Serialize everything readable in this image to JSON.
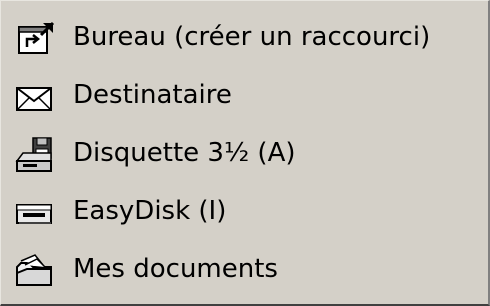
{
  "menu": {
    "items": [
      {
        "label": "Bureau (créer un raccourci)",
        "icon": "desktop-shortcut-icon"
      },
      {
        "label": "Destinataire",
        "icon": "mail-envelope-icon"
      },
      {
        "label": "Disquette 3½ (A)",
        "icon": "floppy-drive-icon"
      },
      {
        "label": "EasyDisk (I)",
        "icon": "removable-disk-icon"
      },
      {
        "label": "Mes documents",
        "icon": "my-documents-folder-icon"
      }
    ]
  }
}
